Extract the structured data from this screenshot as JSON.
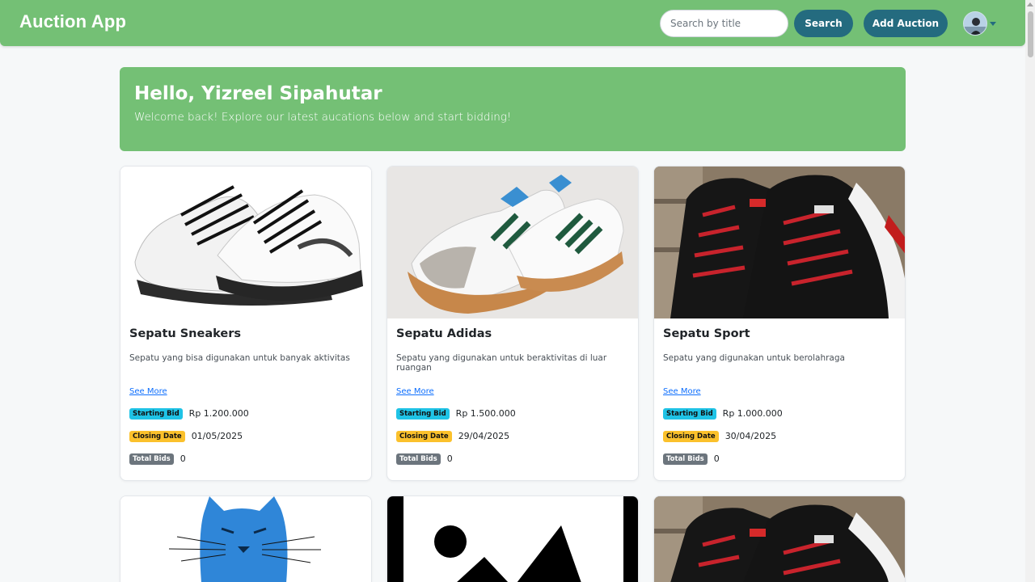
{
  "navbar": {
    "brand": "Auction App",
    "search_placeholder": "Search by title",
    "search_label": "Search",
    "add_label": "Add Auction"
  },
  "hero": {
    "greeting": "Hello, Yizreel Sipahutar",
    "subtitle": "Welcome back! Explore our latest aucations below and start bidding!"
  },
  "labels": {
    "see_more": "See More",
    "starting_bid": "Starting Bid",
    "closing_date": "Closing Date",
    "total_bids": "Total Bids"
  },
  "cards": [
    {
      "title": "Sepatu Sneakers",
      "description": "Sepatu yang bisa digunakan untuk banyak aktivitas",
      "starting_bid": "Rp 1.200.000",
      "closing_date": "01/05/2025",
      "total_bids": "0",
      "image": "white-sneaker"
    },
    {
      "title": "Sepatu Adidas",
      "description": "Sepatu yang digunakan untuk beraktivitas di luar ruangan",
      "starting_bid": "Rp 1.500.000",
      "closing_date": "29/04/2025",
      "total_bids": "0",
      "image": "adidas-samba"
    },
    {
      "title": "Sepatu Sport",
      "description": "Sepatu yang digunakan untuk berolahraga",
      "starting_bid": "Rp 1.000.000",
      "closing_date": "30/04/2025",
      "total_bids": "0",
      "image": "black-red-runner"
    }
  ],
  "partial_cards": [
    {
      "image": "blue-cat"
    },
    {
      "image": "placeholder-image"
    },
    {
      "image": "black-red-runner"
    }
  ],
  "colors": {
    "navbar": "#74c075",
    "button": "#246b7f",
    "starting_bid_badge": "#1fc3e6",
    "closing_date_badge": "#fbc12c",
    "total_bids_badge": "#6c757d"
  }
}
